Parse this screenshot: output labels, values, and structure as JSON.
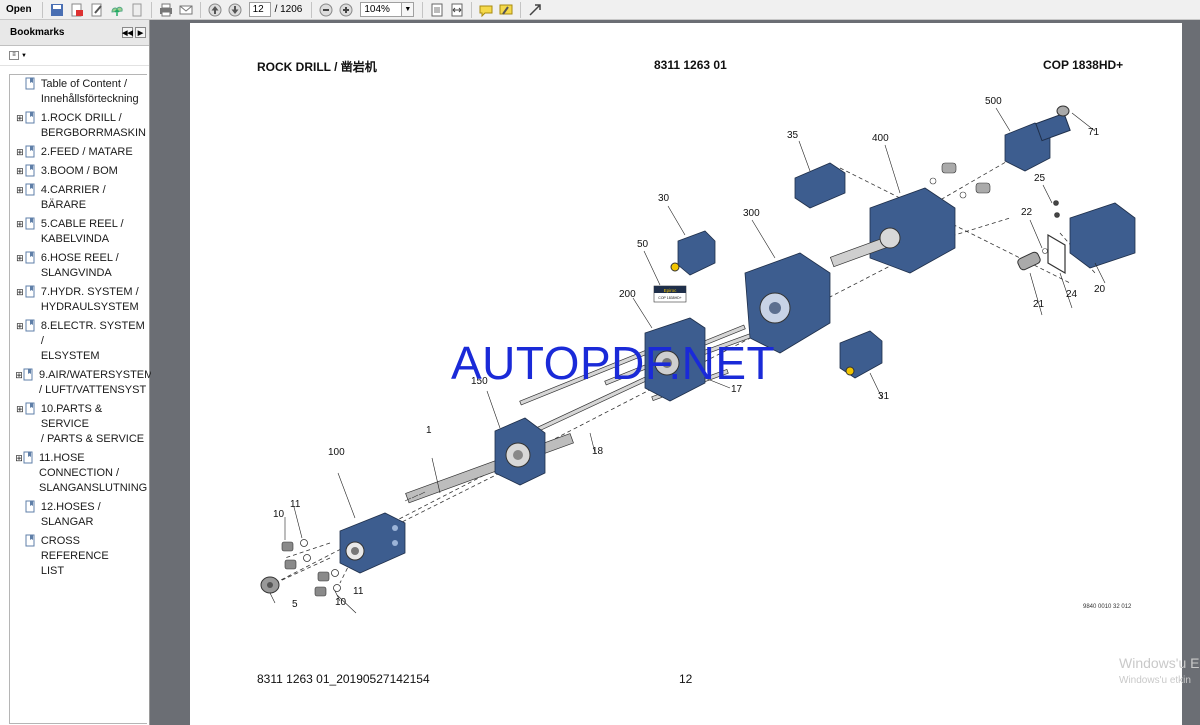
{
  "toolbar": {
    "open_label": "Open",
    "current_page": "12",
    "page_total": "/ 1206",
    "zoom": "104%"
  },
  "sidebar": {
    "title": "Bookmarks",
    "items": [
      {
        "label": "Table of Content /\nInnehållsförteckning",
        "expandable": false
      },
      {
        "label": "1.ROCK DRILL /\nBERGBORRMASKIN",
        "expandable": true
      },
      {
        "label": "2.FEED / MATARE",
        "expandable": true
      },
      {
        "label": "3.BOOM / BOM",
        "expandable": true
      },
      {
        "label": "4.CARRIER / BÄRARE",
        "expandable": true
      },
      {
        "label": "5.CABLE REEL /\nKABELVINDA",
        "expandable": true
      },
      {
        "label": "6.HOSE REEL /\nSLANGVINDA",
        "expandable": true
      },
      {
        "label": "7.HYDR. SYSTEM /\nHYDRAULSYSTEM",
        "expandable": true
      },
      {
        "label": "8.ELECTR. SYSTEM /\nELSYSTEM",
        "expandable": true
      },
      {
        "label": "9.AIR/WATERSYSTEM\n/ LUFT/VATTENSYST",
        "expandable": true
      },
      {
        "label": "10.PARTS & SERVICE\n/ PARTS & SERVICE",
        "expandable": true
      },
      {
        "label": "11.HOSE\nCONNECTION /\nSLANGANSLUTNING",
        "expandable": true
      },
      {
        "label": "12.HOSES /\nSLANGAR",
        "expandable": false
      },
      {
        "label": "CROSS REFERENCE\nLIST",
        "expandable": false
      }
    ]
  },
  "page": {
    "header_left": "ROCK DRILL / 凿岩机",
    "header_center": "8311 1263 01",
    "header_right": "COP 1838HD+",
    "footer_left": "8311 1263 01_20190527142154",
    "footer_page": "12",
    "drawing_code": "9840 0010 32 012",
    "watermark": "AUTOPDF.NET",
    "label_plate_brand": "Epiroc",
    "label_plate_code": "COP 1838HD+"
  },
  "callouts": [
    "500",
    "71",
    "35",
    "400",
    "25",
    "22",
    "30",
    "300",
    "50",
    "20",
    "24",
    "21",
    "200",
    "150",
    "17",
    "31",
    "1",
    "18",
    "100",
    "11",
    "10",
    "5"
  ],
  "os_overlay": {
    "line1": "Windows'u E",
    "line2": "Windows'u etkin"
  },
  "colors": {
    "part_blue": "#3d5d8f",
    "watermark": "#1a2ad8"
  }
}
